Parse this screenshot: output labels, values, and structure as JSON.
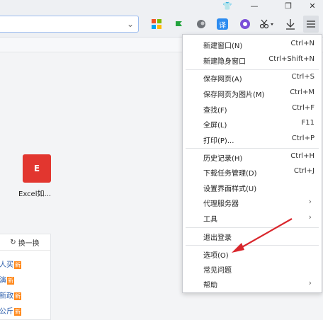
{
  "window": {
    "controls": [
      {
        "name": "shirt-icon",
        "glyph": "👕"
      },
      {
        "name": "minimize-button",
        "glyph": "—"
      },
      {
        "name": "restore-button",
        "glyph": "❐"
      },
      {
        "name": "close-button",
        "glyph": "✕"
      }
    ]
  },
  "toolbar": {
    "translate_label": "译"
  },
  "newtab": {
    "tile_letter": "E",
    "tile_label": "Excel如...",
    "refresh_label": "换一换",
    "news": [
      {
        "text": "人买",
        "badge": "新"
      },
      {
        "text": "演",
        "badge": "新"
      },
      {
        "text": "新政",
        "badge": "新"
      },
      {
        "text": "公斤",
        "badge": "新"
      }
    ]
  },
  "menu": {
    "items": [
      {
        "label": "新建窗口(N)",
        "shortcut": "Ctrl+N",
        "name": "menu-new-window"
      },
      {
        "label": "新建隐身窗口",
        "shortcut": "Ctrl+Shift+N",
        "name": "menu-new-incognito"
      },
      {
        "label": "保存网页(A)",
        "shortcut": "Ctrl+S",
        "name": "menu-save-page"
      },
      {
        "label": "保存网页为图片(M)",
        "shortcut": "Ctrl+M",
        "name": "menu-save-as-image"
      },
      {
        "label": "查找(F)",
        "shortcut": "Ctrl+F",
        "name": "menu-find"
      },
      {
        "label": "全屏(L)",
        "shortcut": "F11",
        "name": "menu-fullscreen"
      },
      {
        "label": "打印(P)...",
        "shortcut": "Ctrl+P",
        "name": "menu-print"
      },
      {
        "label": "历史记录(H)",
        "shortcut": "Ctrl+H",
        "name": "menu-history"
      },
      {
        "label": "下载任务管理(D)",
        "shortcut": "Ctrl+J",
        "name": "menu-downloads"
      },
      {
        "label": "设置界面样式(U)",
        "shortcut": "",
        "name": "menu-ui-style"
      },
      {
        "label": "代理服务器",
        "shortcut": "",
        "name": "menu-proxy",
        "submenu": true
      },
      {
        "label": "工具",
        "shortcut": "",
        "name": "menu-tools",
        "submenu": true
      },
      {
        "label": "退出登录",
        "shortcut": "",
        "name": "menu-logout"
      },
      {
        "label": "选项(O)",
        "shortcut": "",
        "name": "menu-options"
      },
      {
        "label": "常见问题",
        "shortcut": "",
        "name": "menu-faq"
      },
      {
        "label": "帮助",
        "shortcut": "",
        "name": "menu-help",
        "submenu": true
      }
    ]
  },
  "colors": {
    "annotation_arrow": "#d9262c",
    "new_badge": "#ff8a1e",
    "tile": "#e2362f"
  }
}
